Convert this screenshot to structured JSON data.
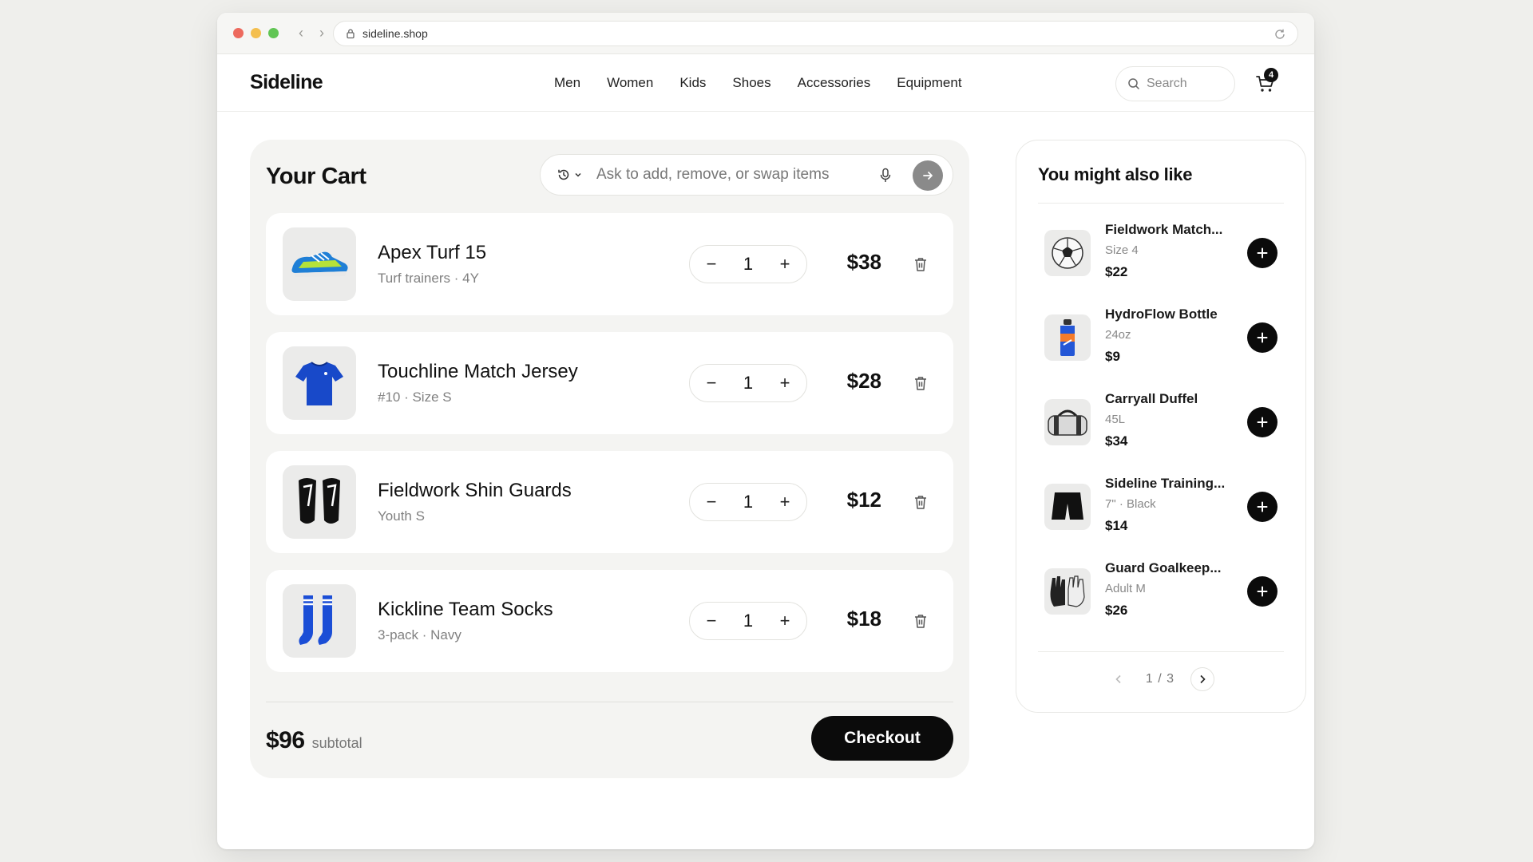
{
  "browser": {
    "url": "sideline.shop",
    "traffic_lights": [
      "#ed6a5e",
      "#f4bf4f",
      "#61c554"
    ]
  },
  "site": {
    "logo": "Sideline",
    "nav": [
      "Men",
      "Women",
      "Kids",
      "Shoes",
      "Accessories",
      "Equipment"
    ],
    "search_placeholder": "Search",
    "cart_count": "4"
  },
  "cart": {
    "title": "Your Cart",
    "assistant_placeholder": "Ask to add, remove, or swap items",
    "items": [
      {
        "name": "Apex Turf 15",
        "details": "Turf trainers · 4Y",
        "qty": "1",
        "price": "$38",
        "icon": "turf-shoe-icon"
      },
      {
        "name": "Touchline Match Jersey",
        "details": "#10 · Size S",
        "qty": "1",
        "price": "$28",
        "icon": "jersey-icon"
      },
      {
        "name": "Fieldwork Shin Guards",
        "details": "Youth S",
        "qty": "1",
        "price": "$12",
        "icon": "shin-guards-icon"
      },
      {
        "name": "Kickline Team Socks",
        "details": "3-pack · Navy",
        "qty": "1",
        "price": "$18",
        "icon": "socks-icon"
      }
    ],
    "subtotal_amount": "$96",
    "subtotal_label": "subtotal",
    "checkout_label": "Checkout"
  },
  "recommendations": {
    "title": "You might also like",
    "items": [
      {
        "name": "Fieldwork Match...",
        "details": "Size 4",
        "price": "$22",
        "icon": "soccer-ball-icon"
      },
      {
        "name": "HydroFlow Bottle",
        "details": "24oz",
        "price": "$9",
        "icon": "water-bottle-icon"
      },
      {
        "name": "Carryall Duffel",
        "details": "45L",
        "price": "$34",
        "icon": "duffel-bag-icon"
      },
      {
        "name": "Sideline Training...",
        "details": "7\" · Black",
        "price": "$14",
        "icon": "shorts-icon"
      },
      {
        "name": "Guard Goalkeep...",
        "details": "Adult M",
        "price": "$26",
        "icon": "goalkeeper-gloves-icon"
      }
    ],
    "pagination": "1 / 3"
  }
}
